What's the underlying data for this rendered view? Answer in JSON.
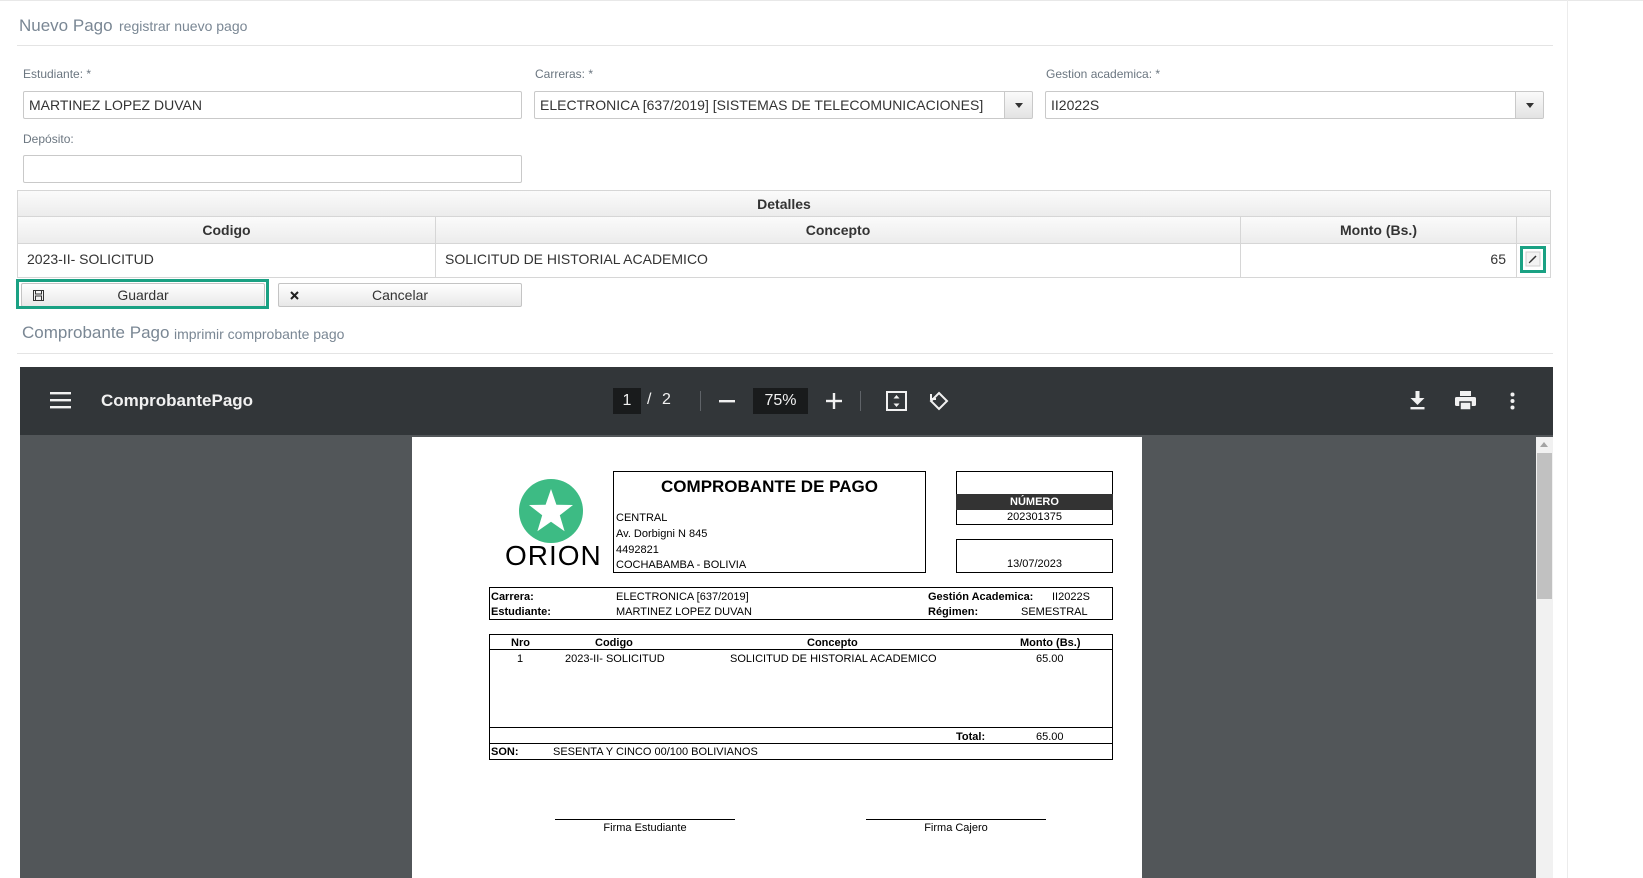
{
  "nuevo_pago": {
    "title": "Nuevo Pago",
    "subtitle": "registrar nuevo pago"
  },
  "form": {
    "estudiante_label": "Estudiante: *",
    "estudiante_value": "MARTINEZ  LOPEZ DUVAN",
    "carreras_label": "Carreras: *",
    "carreras_value": "ELECTRONICA [637/2019] [SISTEMAS DE TELECOMUNICACIONES]",
    "gestion_label": "Gestion academica: *",
    "gestion_value": "II2022S",
    "deposito_label": "Depósito:",
    "deposito_value": ""
  },
  "detalles": {
    "title": "Detalles",
    "columns": [
      "Codigo",
      "Concepto",
      "Monto (Bs.)"
    ],
    "rows": [
      {
        "codigo": "2023-II- SOLICITUD",
        "concepto": "SOLICITUD DE HISTORIAL ACADEMICO",
        "monto": "65"
      }
    ]
  },
  "buttons": {
    "guardar": "Guardar",
    "cancelar": "Cancelar"
  },
  "comprobante": {
    "title": "Comprobante Pago",
    "subtitle": "imprimir comprobante pago"
  },
  "viewer": {
    "filename": "ComprobantePago",
    "current_page": "1",
    "page_sep": "/",
    "total_pages": "2",
    "zoom": "75%"
  },
  "receipt": {
    "logo_text": "ORION",
    "heading": "COMPROBANTE DE PAGO",
    "office": "CENTRAL",
    "address": "Av. Dorbigni N 845",
    "phone": "4492821",
    "city": "COCHABAMBA - BOLIVIA",
    "numero_label": "NÚMERO",
    "numero": "202301375",
    "date": "13/07/2023",
    "carrera_label": "Carrera:",
    "carrera": "ELECTRONICA [637/2019]",
    "estudiante_label": "Estudiante:",
    "estudiante": "MARTINEZ  LOPEZ DUVAN",
    "gestion_label": "Gestión Academica:",
    "gestion": "II2022S",
    "regimen_label": "Régimen:",
    "regimen": "SEMESTRAL",
    "table_headers": [
      "Nro",
      "Codigo",
      "Concepto",
      "Monto (Bs.)"
    ],
    "items": [
      {
        "nro": "1",
        "codigo": "2023-II- SOLICITUD",
        "concepto": "SOLICITUD DE HISTORIAL ACADEMICO",
        "monto": "65.00"
      }
    ],
    "total_label": "Total:",
    "total": "65.00",
    "son_label": "SON:",
    "son": "SESENTA Y CINCO 00/100 BOLIVIANOS",
    "firma_estudiante": "Firma Estudiante",
    "firma_cajero": "Firma Cajero"
  },
  "colors": {
    "highlight": "#1aa183",
    "logo_green": "#3dbb84",
    "toolbar": "#323639",
    "viewer_bg": "#525659"
  },
  "icons": [
    "save-icon",
    "close-icon",
    "edit-icon",
    "menu-icon",
    "minus-icon",
    "plus-icon",
    "fit-page-icon",
    "rotate-icon",
    "download-icon",
    "print-icon",
    "more-vert-icon",
    "star-icon",
    "chevron-down-icon"
  ]
}
